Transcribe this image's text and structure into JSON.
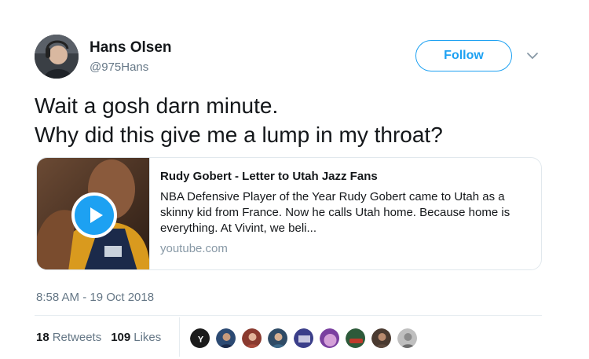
{
  "tweet": {
    "author_name": "Hans Olsen",
    "author_handle": "@975Hans",
    "follow_label": "Follow",
    "text_line_1": "Wait a gosh darn minute.",
    "text_line_2": "Why did this give me a lump in my throat?",
    "timestamp": "8:58 AM - 19 Oct 2018"
  },
  "card": {
    "title": "Rudy Gobert - Letter to Utah Jazz Fans",
    "description": "NBA Defensive Player of the Year Rudy Gobert came to Utah as a skinny kid from France. Now he calls Utah home. Because home is everything. At Vivint, we beli...",
    "domain": "youtube.com",
    "play_icon": "play-icon"
  },
  "stats": {
    "retweets_count": "18",
    "retweets_label": "Retweets",
    "likes_count": "109",
    "likes_label": "Likes"
  },
  "likers": [
    "liker-1",
    "liker-2",
    "liker-3",
    "liker-4",
    "liker-5",
    "liker-6",
    "liker-7",
    "liker-8",
    "liker-9"
  ],
  "colors": {
    "accent": "#1da1f2",
    "text": "#14171a",
    "muted": "#657786",
    "border": "#e1e8ed"
  }
}
